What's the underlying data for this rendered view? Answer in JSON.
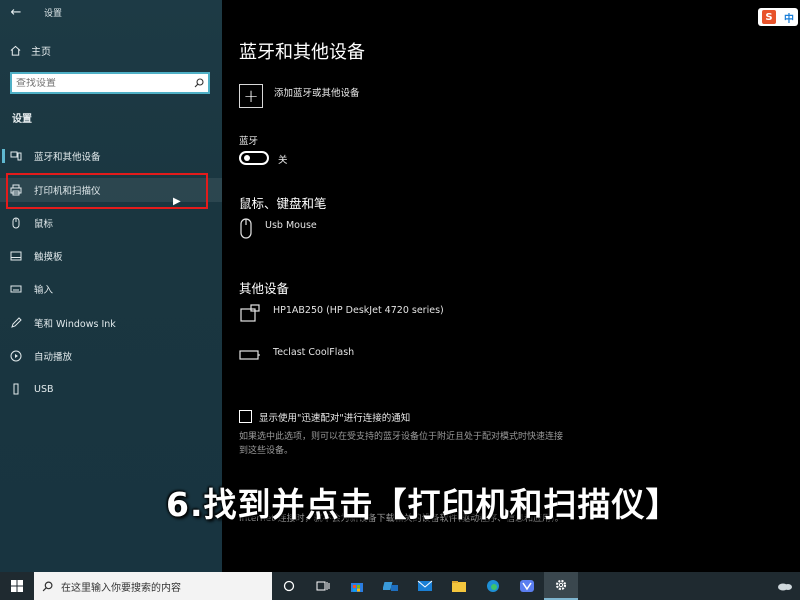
{
  "window": {
    "title": "设置",
    "back_glyph": "←"
  },
  "sidebar": {
    "home_label": "主页",
    "search_placeholder": "查找设置",
    "section_label": "设置",
    "items": [
      {
        "label": "蓝牙和其他设备",
        "icon": "bluetooth-devices-icon"
      },
      {
        "label": "打印机和扫描仪",
        "icon": "printer-icon"
      },
      {
        "label": "鼠标",
        "icon": "mouse-icon"
      },
      {
        "label": "触摸板",
        "icon": "touchpad-icon"
      },
      {
        "label": "输入",
        "icon": "keyboard-icon"
      },
      {
        "label": "笔和 Windows Ink",
        "icon": "pen-icon"
      },
      {
        "label": "自动播放",
        "icon": "autoplay-icon"
      },
      {
        "label": "USB",
        "icon": "usb-icon"
      }
    ]
  },
  "main": {
    "title": "蓝牙和其他设备",
    "add_device_label": "添加蓝牙或其他设备",
    "bluetooth_label": "蓝牙",
    "bluetooth_state": "关",
    "mouse_section": "鼠标、键盘和笔",
    "mouse_devices": [
      {
        "name": "Usb Mouse",
        "icon": "mouse-icon"
      }
    ],
    "other_section": "其他设备",
    "other_devices": [
      {
        "name": "HP1AB250 (HP DeskJet 4720 series)",
        "icon": "printer-device-icon"
      },
      {
        "name": "Teclast CoolFlash",
        "icon": "usb-drive-icon"
      }
    ],
    "swift_pair_label": "显示使用\"迅速配对\"进行连接的通知",
    "swift_pair_desc": "如果选中此选项，则可以在受支持的蓝牙设备位于附近且处于配对模式时快速连接到这些设备。",
    "metered_desc": "Internet 连接时，就不会为新设备下载相关的设备软件(驱动程序、信息和应用)。"
  },
  "overlay_caption": "6.找到并点击【打印机和扫描仪】",
  "ime": {
    "logo": "S",
    "mode": "中"
  },
  "taskbar": {
    "search_placeholder": "在这里输入你要搜索的内容",
    "icons": [
      "cortana-icon",
      "task-view-icon",
      "store-icon",
      "onedrive-icon",
      "mail-icon",
      "file-explorer-icon",
      "edge-icon",
      "vpn-icon",
      "settings-gear-icon"
    ]
  },
  "colors": {
    "accent": "#5fb8d0",
    "highlight_red": "#e31b1b",
    "sidebar_bg": "#1a3640"
  }
}
